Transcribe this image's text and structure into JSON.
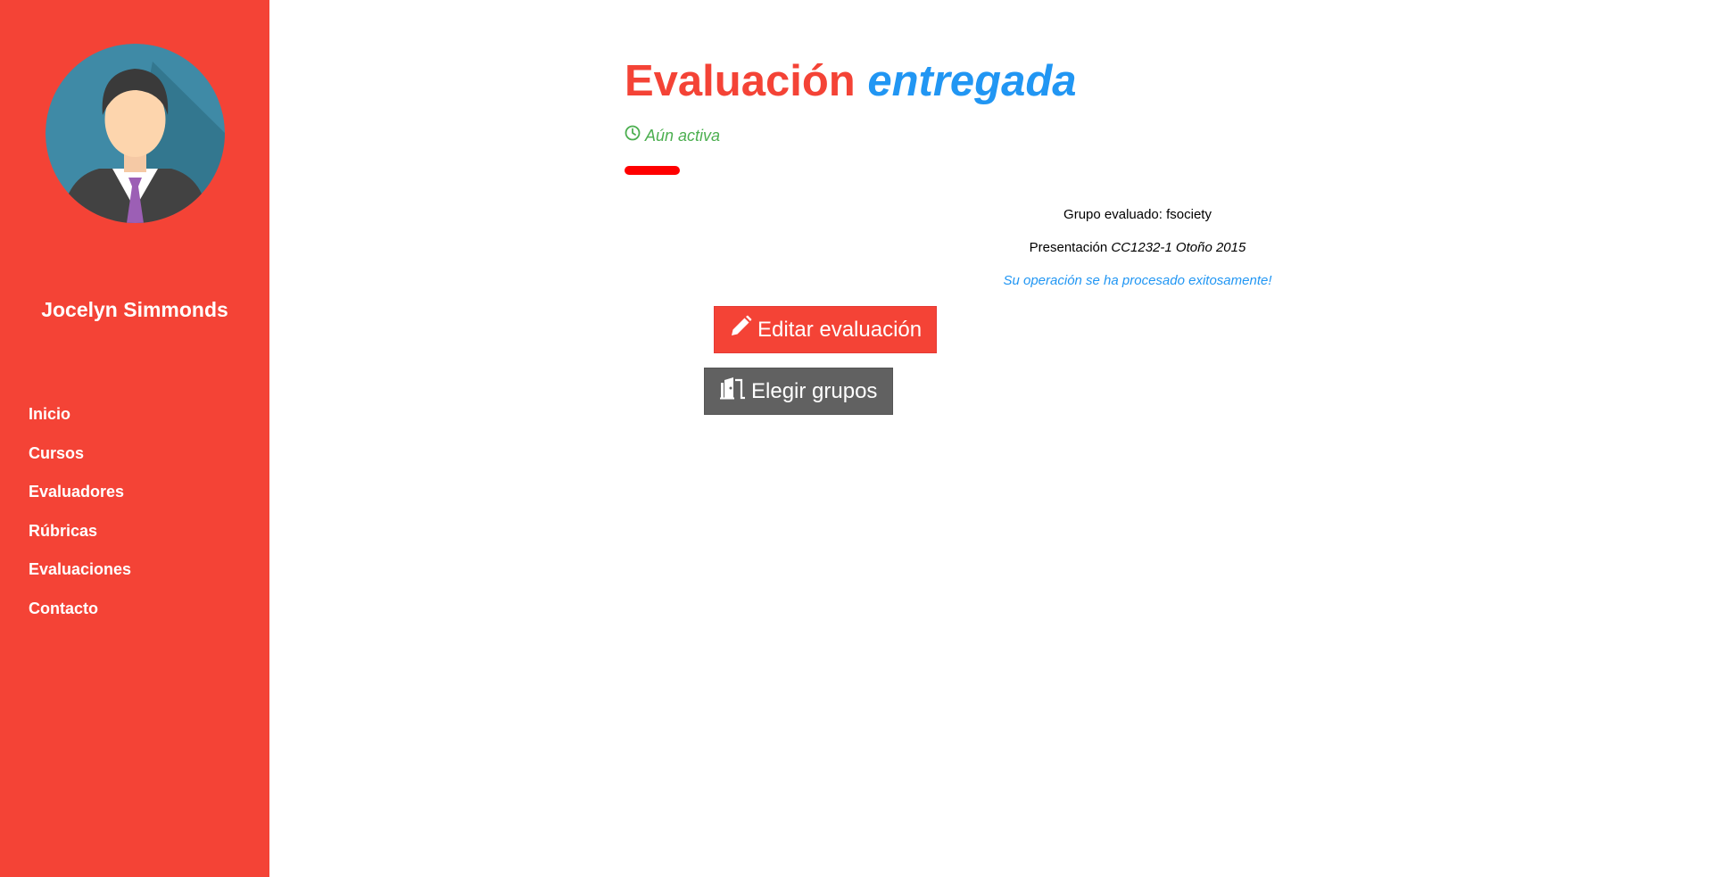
{
  "sidebar": {
    "user_name": "Jocelyn Simmonds",
    "avatar_icon": "user-avatar-icon",
    "nav": [
      {
        "label": "Inicio"
      },
      {
        "label": "Cursos"
      },
      {
        "label": "Evaluadores"
      },
      {
        "label": "Rúbricas"
      },
      {
        "label": "Evaluaciones"
      },
      {
        "label": "Contacto"
      }
    ]
  },
  "main": {
    "title_part1": "Evaluación",
    "title_part2": "entregada",
    "status": {
      "icon": "clock-icon",
      "text": "Aún activa"
    },
    "grupo": "Grupo evaluado: fsociety",
    "presentacion_label": "Presentación",
    "presentacion_value": "CC1232-1 Otoño 2015",
    "success_message": "Su operación se ha procesado exitosamente!",
    "buttons": {
      "edit": {
        "icon": "pencil-icon",
        "label": "Editar evaluación"
      },
      "groups": {
        "icon": "door-icon",
        "label": "Elegir grupos"
      }
    }
  },
  "colors": {
    "accent_red": "#f44336",
    "accent_blue": "#2196f3",
    "status_green": "#4caf50",
    "button_grey": "#616161"
  }
}
